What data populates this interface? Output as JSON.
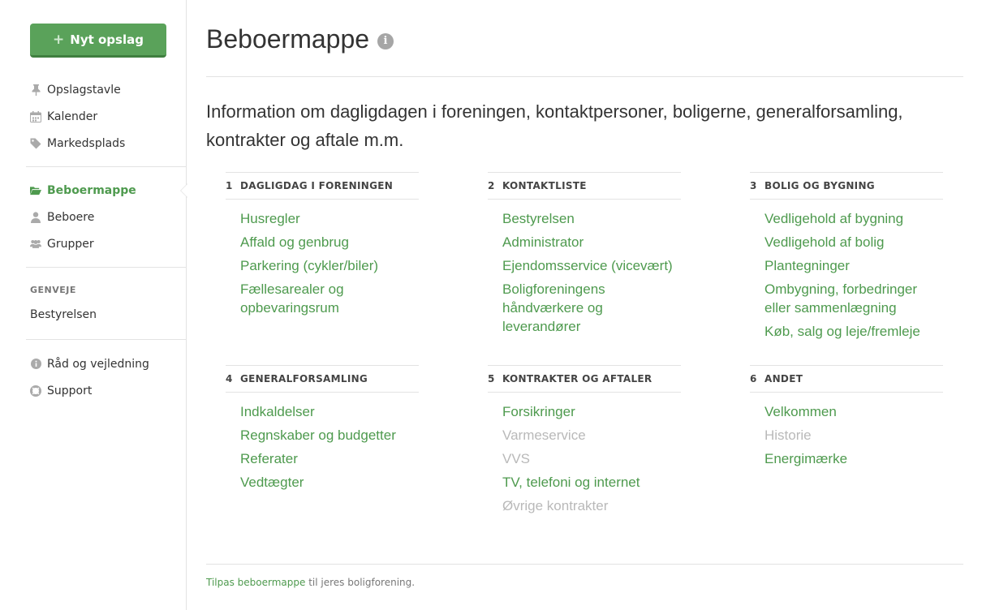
{
  "sidebar": {
    "new_post_label": "Nyt opslag",
    "group1": [
      {
        "label": "Opslagstavle",
        "icon": "pushpin-icon"
      },
      {
        "label": "Kalender",
        "icon": "calendar-icon"
      },
      {
        "label": "Markedsplads",
        "icon": "tag-icon"
      }
    ],
    "group2": [
      {
        "label": "Beboermappe",
        "icon": "folder-open-icon",
        "active": true
      },
      {
        "label": "Beboere",
        "icon": "user-icon"
      },
      {
        "label": "Grupper",
        "icon": "users-icon"
      }
    ],
    "shortcuts_heading": "GENVEJE",
    "shortcuts": [
      {
        "label": "Bestyrelsen"
      }
    ],
    "group3": [
      {
        "label": "Råd og vejledning",
        "icon": "info-circle-icon"
      },
      {
        "label": "Support",
        "icon": "lifebuoy-icon"
      }
    ]
  },
  "main": {
    "title": "Beboermappe",
    "intro": "Information om dagligdagen i foreningen, kontaktpersoner, boligerne, generalforsamling, kontrakter og aftale m.m.",
    "sections": [
      {
        "num": "1",
        "title": "DAGLIGDAG I FORENINGEN",
        "links": [
          {
            "label": "Husregler",
            "enabled": true
          },
          {
            "label": "Affald og genbrug",
            "enabled": true
          },
          {
            "label": "Parkering (cykler/biler)",
            "enabled": true
          },
          {
            "label": "Fællesarealer og opbevaringsrum",
            "enabled": true
          }
        ]
      },
      {
        "num": "2",
        "title": "KONTAKTLISTE",
        "links": [
          {
            "label": "Bestyrelsen",
            "enabled": true
          },
          {
            "label": "Administrator",
            "enabled": true
          },
          {
            "label": "Ejendomsservice (vicevært)",
            "enabled": true
          },
          {
            "label": "Boligforeningens håndværkere og leverandører",
            "enabled": true
          }
        ]
      },
      {
        "num": "3",
        "title": "BOLIG OG BYGNING",
        "links": [
          {
            "label": "Vedligehold af bygning",
            "enabled": true
          },
          {
            "label": "Vedligehold af bolig",
            "enabled": true
          },
          {
            "label": "Plantegninger",
            "enabled": true
          },
          {
            "label": "Ombygning, forbedringer eller sammenlægning",
            "enabled": true
          },
          {
            "label": "Køb, salg og leje/fremleje",
            "enabled": true
          }
        ]
      },
      {
        "num": "4",
        "title": "GENERALFORSAMLING",
        "links": [
          {
            "label": "Indkaldelser",
            "enabled": true
          },
          {
            "label": "Regnskaber og budgetter",
            "enabled": true
          },
          {
            "label": "Referater",
            "enabled": true
          },
          {
            "label": "Vedtægter",
            "enabled": true
          }
        ]
      },
      {
        "num": "5",
        "title": "KONTRAKTER OG AFTALER",
        "links": [
          {
            "label": "Forsikringer",
            "enabled": true
          },
          {
            "label": "Varmeservice",
            "enabled": false
          },
          {
            "label": "VVS",
            "enabled": false
          },
          {
            "label": "TV, telefoni og internet",
            "enabled": true
          },
          {
            "label": "Øvrige kontrakter",
            "enabled": false
          }
        ]
      },
      {
        "num": "6",
        "title": "ANDET",
        "links": [
          {
            "label": "Velkommen",
            "enabled": true
          },
          {
            "label": "Historie",
            "enabled": false
          },
          {
            "label": "Energimærke",
            "enabled": true
          }
        ]
      }
    ],
    "footer": {
      "link_label": "Tilpas beboermappe",
      "rest": " til jeres boligforening."
    }
  },
  "colors": {
    "accent": "#4e9a4e",
    "button": "#5aa25a",
    "disabled": "#b9b9b9"
  }
}
